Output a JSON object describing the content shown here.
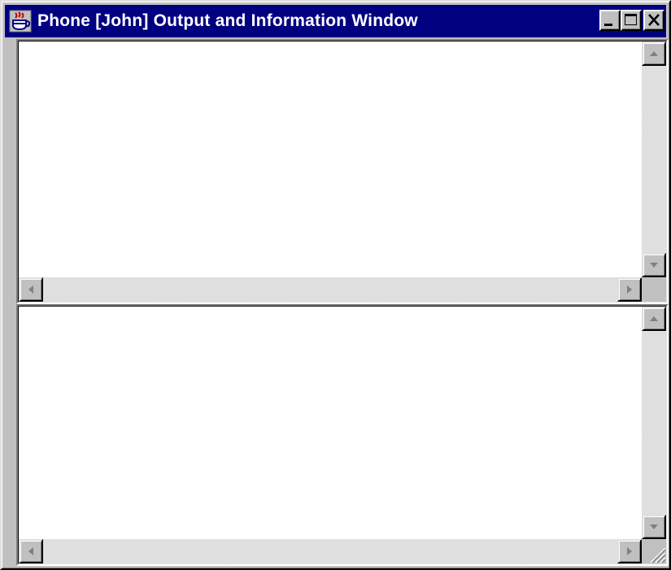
{
  "window": {
    "title": "Phone [John] Output and Information Window",
    "app_icon": "java-cup-icon",
    "controls": {
      "minimize": "minimize-icon",
      "maximize": "maximize-icon",
      "close": "close-icon"
    }
  },
  "panes": {
    "top": {
      "text": ""
    },
    "bottom": {
      "text": ""
    }
  },
  "colors": {
    "titlebar": "#000080",
    "title_text": "#ffffff",
    "face": "#c0c0c0",
    "content": "#ffffff"
  }
}
